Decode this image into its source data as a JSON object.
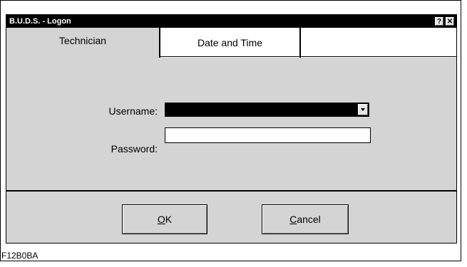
{
  "window": {
    "title": "B.U.D.S. - Logon",
    "help_glyph": "?",
    "close_glyph": "✕"
  },
  "tabs": [
    {
      "label": "Technician",
      "active": true
    },
    {
      "label": "Date and Time",
      "active": false
    }
  ],
  "form": {
    "username_label": "Username:",
    "username_value": "",
    "password_label": "Password:",
    "password_value": ""
  },
  "buttons": {
    "ok_mnemonic": "O",
    "ok_rest": "K",
    "cancel_mnemonic": "C",
    "cancel_rest": "ancel"
  },
  "figure_code": "F12B0BA",
  "icons": {
    "help": "question-mark-icon",
    "close": "close-icon",
    "dropdown": "chevron-down-icon"
  },
  "colors": {
    "titlebar": "#000000",
    "dialog_face": "#d4d4d4",
    "selected_field": "#000000"
  }
}
